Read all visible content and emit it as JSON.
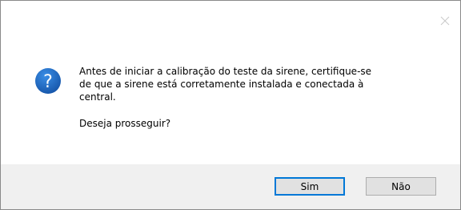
{
  "dialog": {
    "message_line1": "Antes de iniciar a calibração do teste da sirene, certifique-se",
    "message_line2": "de que a sirene está corretamente instalada e conectada à",
    "message_line3": "central.",
    "prompt": "Deseja prosseguir?",
    "icon": "question-icon",
    "close_icon": "close-icon"
  },
  "buttons": {
    "yes_label": "Sim",
    "no_label": "Não",
    "default_accent": "#0078d7"
  },
  "colors": {
    "icon_blue": "#1e63b7",
    "footer_bg": "#f0f0f0"
  }
}
